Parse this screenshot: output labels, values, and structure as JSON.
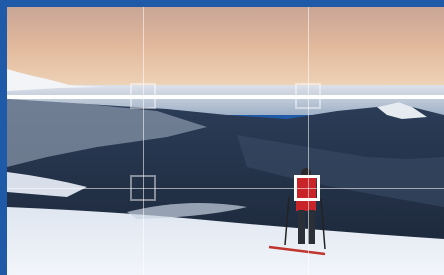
{
  "overlay": {
    "grid": "rule-of-thirds",
    "focus_points": [
      {
        "name": "focus-point-top-left",
        "active": false
      },
      {
        "name": "focus-point-top-right",
        "active": false
      },
      {
        "name": "focus-point-bottom-left",
        "active": false
      },
      {
        "name": "focus-point-bottom-right",
        "active": true
      }
    ],
    "horizon_guide": "visible"
  },
  "photo": {
    "subject": "hiker-on-snow",
    "colors": {
      "sky_top": "#d7aa8d",
      "sky_bottom": "#e8c7a6",
      "mountain_dark": "#1a2a3e",
      "snow": "#e9eef6",
      "frame": "#1e5aa8"
    }
  }
}
